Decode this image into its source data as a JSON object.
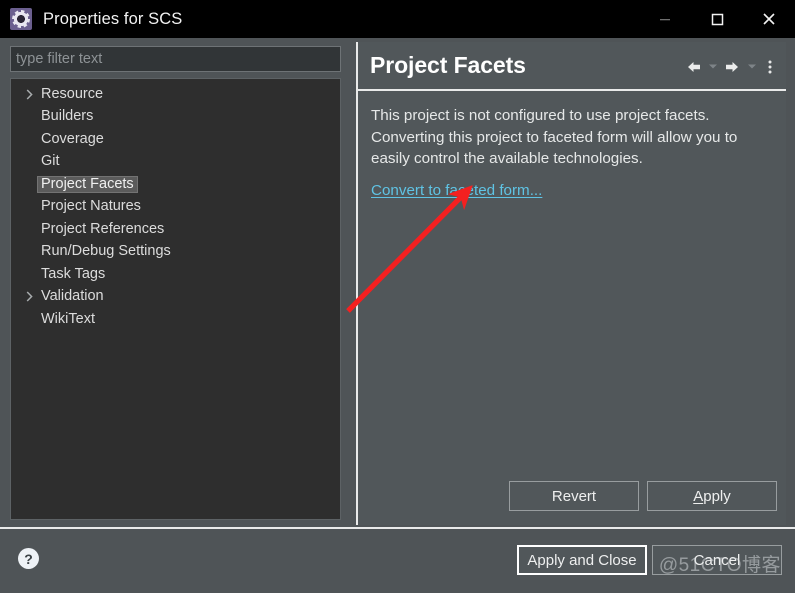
{
  "window": {
    "title": "Properties for SCS",
    "icon": "eclipse-gear-icon",
    "controls": {
      "minimize": "minimize-icon",
      "maximize": "maximize-icon",
      "close": "close-icon"
    }
  },
  "filter": {
    "placeholder": "type filter text",
    "value": ""
  },
  "tree": {
    "items": [
      {
        "label": "Resource",
        "expandable": true,
        "selected": false
      },
      {
        "label": "Builders",
        "expandable": false,
        "selected": false
      },
      {
        "label": "Coverage",
        "expandable": false,
        "selected": false
      },
      {
        "label": "Git",
        "expandable": false,
        "selected": false
      },
      {
        "label": "Project Facets",
        "expandable": false,
        "selected": true
      },
      {
        "label": "Project Natures",
        "expandable": false,
        "selected": false
      },
      {
        "label": "Project References",
        "expandable": false,
        "selected": false
      },
      {
        "label": "Run/Debug Settings",
        "expandable": false,
        "selected": false
      },
      {
        "label": "Task Tags",
        "expandable": false,
        "selected": false
      },
      {
        "label": "Validation",
        "expandable": true,
        "selected": false
      },
      {
        "label": "WikiText",
        "expandable": false,
        "selected": false
      }
    ]
  },
  "panel": {
    "title": "Project Facets",
    "description": "This project is not configured to use project facets. Converting this project to faceted form will allow you to easily control the available technologies.",
    "link_label": "Convert to faceted form...",
    "actions": {
      "back": "back-arrow-icon",
      "back_menu": "chevron-down-icon",
      "forward": "forward-arrow-icon",
      "forward_menu": "chevron-down-icon",
      "overflow": "vertical-ellipsis-icon"
    },
    "buttons": {
      "revert": "Revert",
      "apply_prefix": "",
      "apply_mnemonic": "A",
      "apply_suffix": "pply"
    }
  },
  "dialog": {
    "help": "?",
    "apply_and_close": "Apply and Close",
    "cancel": "Cancel"
  },
  "annotation": {
    "arrow_color": "#f42020",
    "from": "348,311",
    "to": "468,190"
  },
  "watermark": {
    "text": "@51CTO博客"
  },
  "colors": {
    "titlebar_bg": "#000000",
    "dialog_bg": "#4f5457",
    "tree_bg": "#2e2e2e",
    "panel_bg": "#51575a",
    "link": "#5fc3e4",
    "selection": "#5b5b5b",
    "separator": "#e9eaea"
  }
}
